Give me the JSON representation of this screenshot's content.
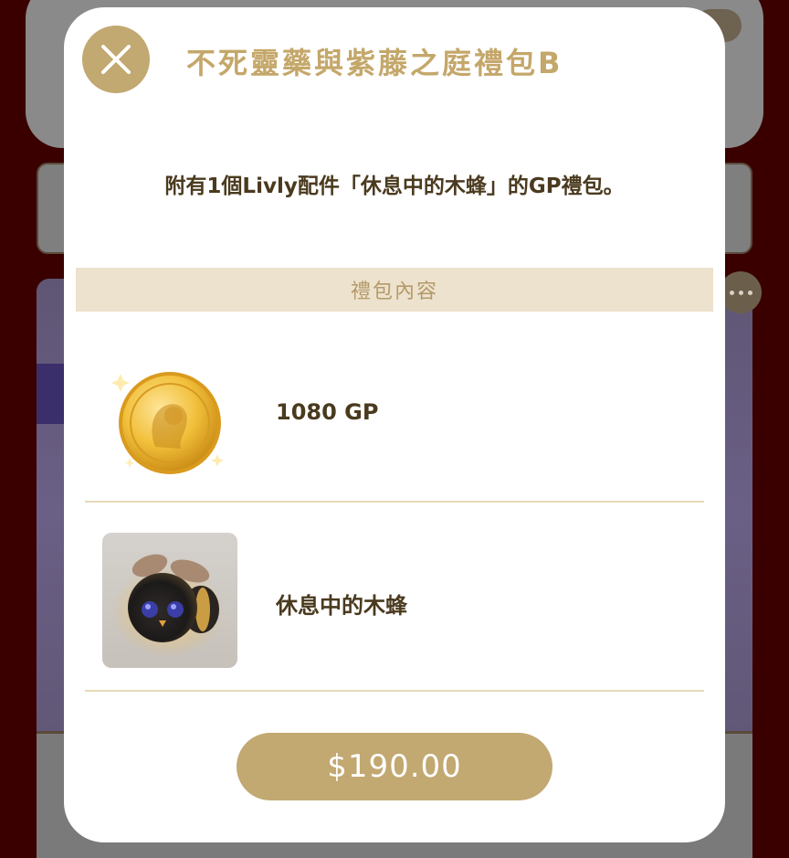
{
  "modal": {
    "title": "不死靈藥與紫藤之庭禮包B",
    "description": "附有1個Livly配件「休息中的木蜂」的GP禮包。",
    "section_header": "禮包內容",
    "items": [
      {
        "label": "1080 GP",
        "icon": "gold-coin-icon"
      },
      {
        "label": "休息中的木蜂",
        "icon": "resting-bee-icon"
      }
    ],
    "price": "$190.00"
  },
  "colors": {
    "accent": "#c2a871",
    "title": "#c4a76a",
    "text": "#4a3a1e",
    "section_bg": "#ede2cd",
    "page_bg": "#3a0000"
  }
}
